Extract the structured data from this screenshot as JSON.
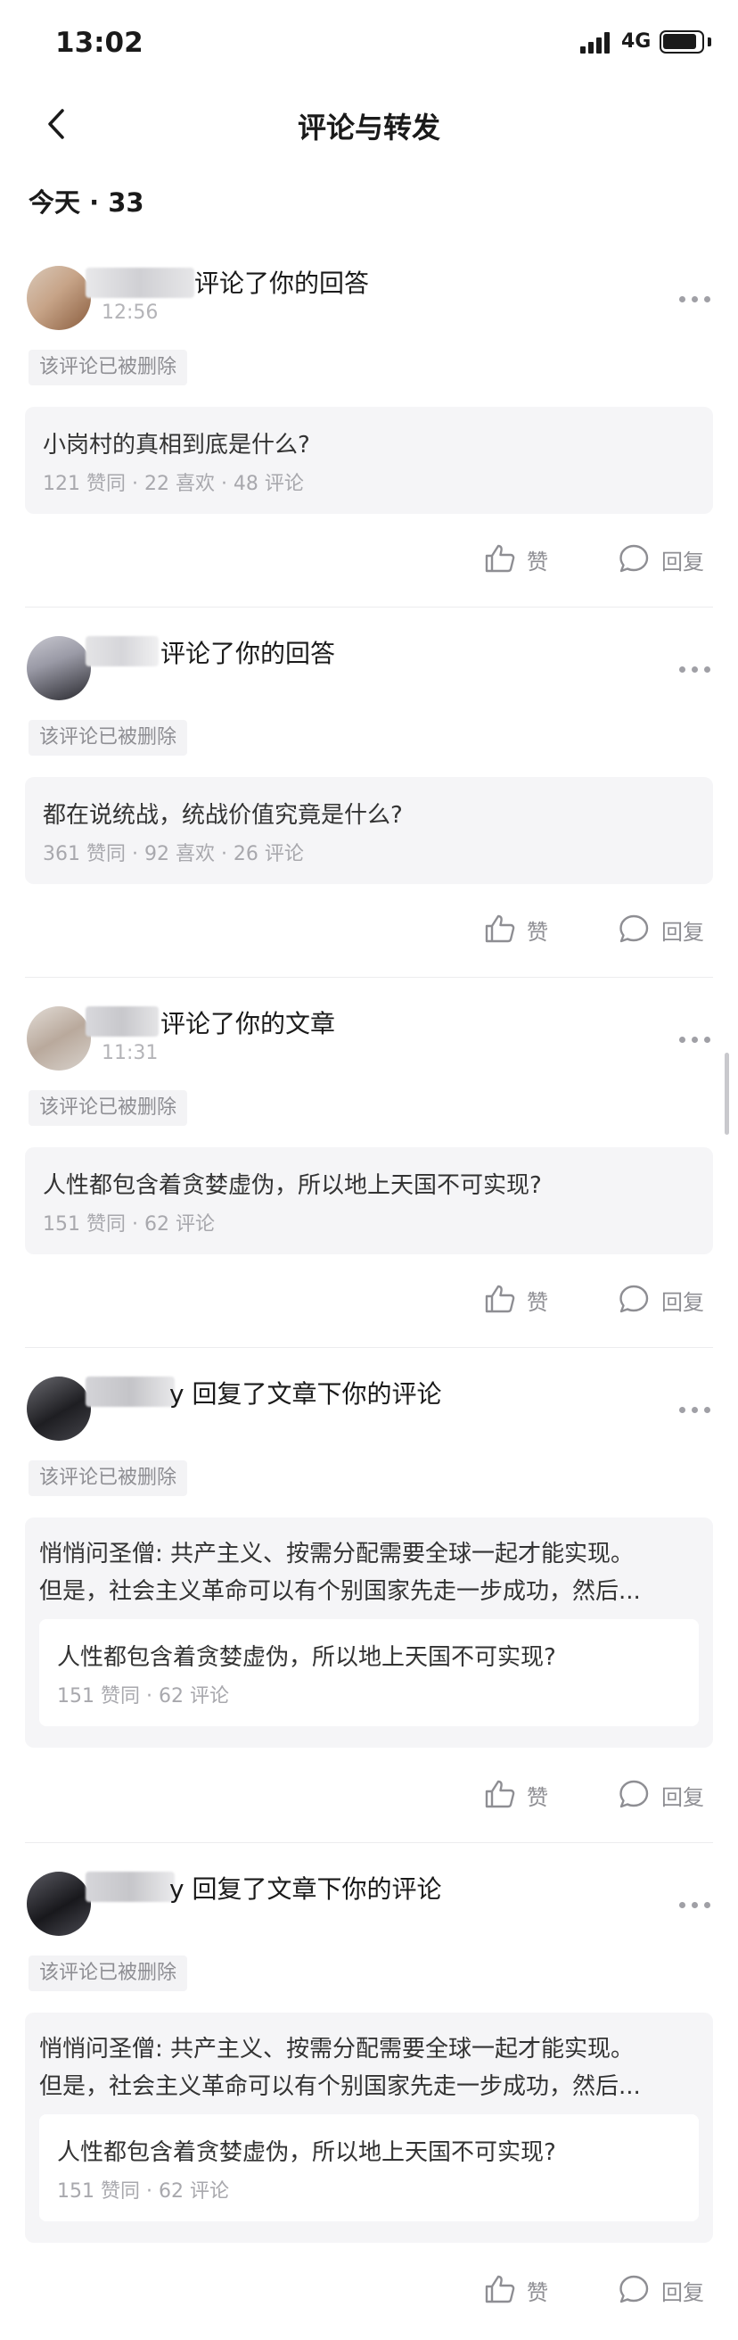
{
  "status": {
    "time": "13:02",
    "network": "4G"
  },
  "nav": {
    "title": "评论与转发"
  },
  "section": {
    "heading": "今天 · 33"
  },
  "labels": {
    "deleted": "该评论已被删除",
    "like": "赞",
    "reply": "回复"
  },
  "items": [
    {
      "action_text": "评论了你的回答",
      "time": "12:56",
      "card_title": "小岗村的真相到底是什么?",
      "card_meta": "121 赞同 · 22 喜欢 · 48 评论"
    },
    {
      "action_text": "评论了你的回答",
      "time": "",
      "card_title": "都在说统战，统战价值究竟是什么?",
      "card_meta": "361 赞同 · 92 喜欢 · 26 评论"
    },
    {
      "action_text": "评论了你的文章",
      "time": "11:31",
      "card_title": "人性都包含着贪婪虚伪，所以地上天国不可实现?",
      "card_meta": "151 赞同 · 62 评论"
    },
    {
      "action_text": "y 回复了文章下你的评论",
      "time": "",
      "comment_line1": "悄悄问圣僧: 共产主义、按需分配需要全球一起才能实现。",
      "comment_line2": "但是，社会主义革命可以有个别国家先走一步成功，然后...",
      "card_title": "人性都包含着贪婪虚伪，所以地上天国不可实现?",
      "card_meta": "151 赞同 · 62 评论"
    },
    {
      "action_text": "y 回复了文章下你的评论",
      "time": "",
      "comment_line1": "悄悄问圣僧: 共产主义、按需分配需要全球一起才能实现。",
      "comment_line2": "但是，社会主义革命可以有个别国家先走一步成功，然后...",
      "card_title": "人性都包含着贪婪虚伪，所以地上天国不可实现?",
      "card_meta": "151 赞同 · 62 评论"
    }
  ]
}
